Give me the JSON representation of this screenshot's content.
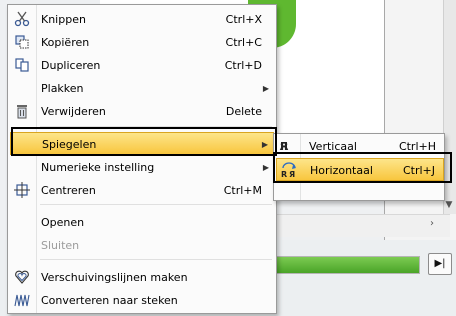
{
  "menu": {
    "items": [
      {
        "label": "Knippen",
        "accel": "Ctrl+X",
        "icon": "scissors-icon"
      },
      {
        "label": "Kopiëren",
        "accel": "Ctrl+C",
        "icon": "copy-icon"
      },
      {
        "label": "Dupliceren",
        "accel": "Ctrl+D",
        "icon": "duplicate-icon"
      },
      {
        "label": "Plakken",
        "accel": "",
        "icon": "",
        "submenu": true
      },
      {
        "label": "Verwijderen",
        "accel": "Delete",
        "icon": "trash-icon"
      },
      {
        "label": "Spiegelen",
        "accel": "",
        "icon": "",
        "submenu": true,
        "highlighted": true
      },
      {
        "label": "Numerieke instelling",
        "accel": "",
        "icon": "",
        "submenu": true
      },
      {
        "label": "Centreren",
        "accel": "Ctrl+M",
        "icon": "center-icon"
      },
      {
        "label": "Openen",
        "accel": "",
        "icon": ""
      },
      {
        "label": "Sluiten",
        "accel": "",
        "icon": "",
        "disabled": true
      },
      {
        "label": "Verschuivingslijnen maken",
        "accel": "",
        "icon": "heart-outline-icon"
      },
      {
        "label": "Converteren naar steken",
        "accel": "",
        "icon": "stitches-icon"
      }
    ],
    "arrow_glyph": "▶"
  },
  "submenu": {
    "items": [
      {
        "label": "Verticaal",
        "accel": "Ctrl+H",
        "icon": "flip-vertical-icon"
      },
      {
        "label": "Horizontaal",
        "accel": "Ctrl+J",
        "icon": "flip-horizontal-icon",
        "highlighted": true
      }
    ]
  },
  "scroll": {
    "down_arrow": "▼",
    "right_arrow": "›"
  },
  "player": {
    "progress": 1.0,
    "skip_end_glyph": "▶|"
  },
  "colors": {
    "highlight_top": "#fde58a",
    "highlight_bottom": "#f8c63e",
    "green_accent": "#5fb830",
    "callout_border": "#000000"
  }
}
